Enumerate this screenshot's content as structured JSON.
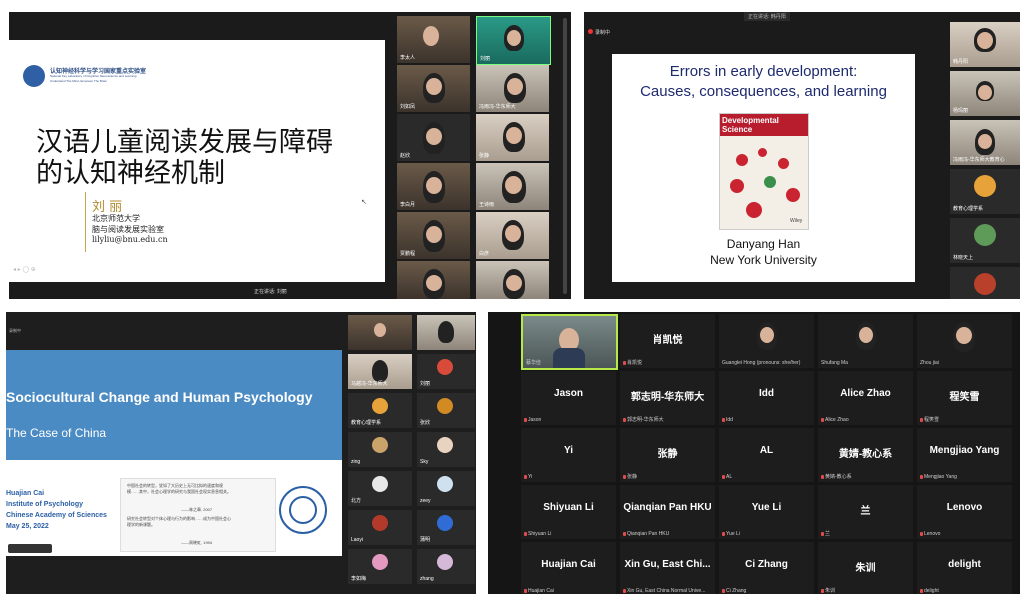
{
  "p1": {
    "lab_cn": "认知神经科学与学习国家重点实验室",
    "lab_en1": "National Key Laboratory of Cognitive Neuroscience and Learning",
    "lab_en2": "Understand The Mind, Empower The Brain",
    "title1": "汉语儿童阅读发展与障碍",
    "title2": "的认知神经机制",
    "speaker": "刘 丽",
    "affil1": "北京师范大学",
    "affil2": "脑与阅读发展实验室",
    "email": "lilyliu@bnu.edu.cn",
    "speaking": "正在讲话: 刘丽",
    "tiles": [
      "李太人",
      "刘丽",
      "刘如凤",
      "冯雨冯-华东师大",
      "赵欣",
      "张静",
      "李白月",
      "王诗雨",
      "贾鹏程",
      "白彦",
      "",
      ""
    ]
  },
  "p2": {
    "top_label": "正在讲话: 韩丹阳",
    "recording": "录制中",
    "title1": "Errors in early development:",
    "title2": "Causes, consequences, and learning",
    "journal1": "Developmental",
    "journal2": "Science",
    "journal_caption": "Wiley",
    "speaker": "Danyang Han",
    "affil": "New York University",
    "tiles": [
      "韩丹阳",
      "杨玛丽",
      "冯雨冯-华东师大教育心",
      "教育心理学系",
      "林晓天上",
      ""
    ]
  },
  "p3": {
    "recording": "录制中",
    "title": "Sociocultural Change and Human Psychology",
    "subtitle": "The Case of China",
    "author": "Huajian Cai",
    "inst1": "Institute of Psychology",
    "inst2": "Chinese Academy of Sciences",
    "date": "May 25, 2022",
    "quote_text": "中国社会的转型，犹如了大历史上无可比拟的速度和规模……其中，社会心理学的研究与我国社会现实息息相关。",
    "quote_attr1": "——林之章, 2007",
    "quote_text2": "研究社会转型对个体心理与行为的影响……成为中国社会心理学的新课题。",
    "quote_attr2": "——周晓虹, 1994",
    "tiles": [
      "",
      "",
      "马越冯-华东师大",
      "刘丽",
      "教育心理学系",
      "张欣",
      "zing",
      "Sky",
      "北方",
      "zeey",
      "Laoyi",
      "蒲明",
      "李如梅",
      "zhang"
    ]
  },
  "p4": {
    "top": [
      {
        "big": "",
        "small": "蔡华俭"
      },
      {
        "big": "肖凯悦",
        "small": "肖凯悦"
      },
      {
        "big": "",
        "small": "Guanglei Hong (pronouns: she/her)"
      },
      {
        "big": "",
        "small": "Shufang Ma"
      },
      {
        "big": "",
        "small": "Zhou jiai"
      }
    ],
    "rows": [
      [
        {
          "big": "Jason",
          "small": "Jason"
        },
        {
          "big": "郭志明-华东师大",
          "small": "郭志明-华东师大"
        },
        {
          "big": "Idd",
          "small": "Idd"
        },
        {
          "big": "Alice Zhao",
          "small": "Alice Zhao"
        },
        {
          "big": "程笑雪",
          "small": "程笑雪"
        }
      ],
      [
        {
          "big": "Yi",
          "small": "Yi"
        },
        {
          "big": "张静",
          "small": "张静"
        },
        {
          "big": "AL",
          "small": "AL"
        },
        {
          "big": "黄婧-教心系",
          "small": "黄婧-教心系"
        },
        {
          "big": "Mengjiao Yang",
          "small": "Mengjiao Yang"
        }
      ],
      [
        {
          "big": "Shiyuan Li",
          "small": "Shiyuan Li"
        },
        {
          "big": "Qianqian Pan HKU",
          "small": "Qianqian Pan HKU"
        },
        {
          "big": "Yue Li",
          "small": "Yue Li"
        },
        {
          "big": "兰",
          "small": "兰"
        },
        {
          "big": "Lenovo",
          "small": "Lenovo"
        }
      ],
      [
        {
          "big": "Huajian Cai",
          "small": "Huajian Cai"
        },
        {
          "big": "Xin Gu, East Chi...",
          "small": "Xin Gu, East China Normal Unive..."
        },
        {
          "big": "Ci Zhang",
          "small": "Ci Zhang"
        },
        {
          "big": "朱训",
          "small": "朱训"
        },
        {
          "big": "delight",
          "small": "delight"
        }
      ]
    ]
  }
}
